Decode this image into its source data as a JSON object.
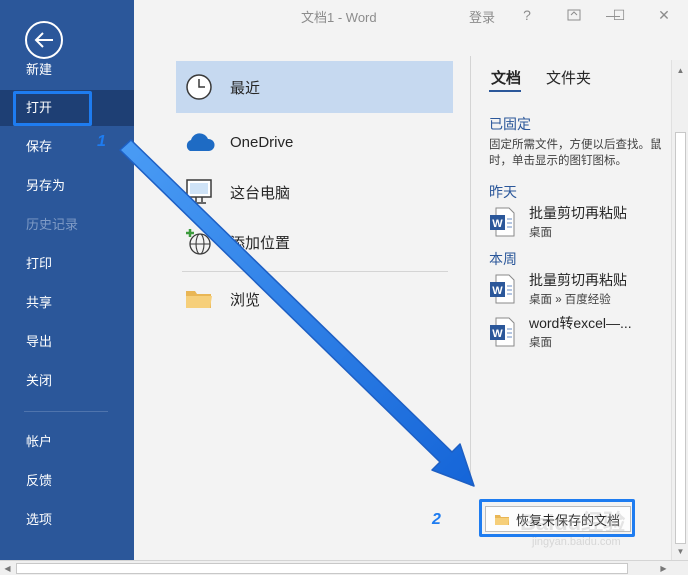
{
  "window": {
    "title": "文档1 -  Word",
    "login": "登录",
    "help": "?",
    "minimize": "—",
    "restore": "☐",
    "close": "✕"
  },
  "sidebar": {
    "items": [
      {
        "label": "新建"
      },
      {
        "label": "打开"
      },
      {
        "label": "保存"
      },
      {
        "label": "另存为"
      },
      {
        "label": "历史记录"
      },
      {
        "label": "打印"
      },
      {
        "label": "共享"
      },
      {
        "label": "导出"
      },
      {
        "label": "关闭"
      },
      {
        "label": "帐户"
      },
      {
        "label": "反馈"
      },
      {
        "label": "选项"
      }
    ]
  },
  "locations": [
    {
      "label": "最近",
      "icon": "clock-icon"
    },
    {
      "label": "OneDrive",
      "icon": "cloud-icon"
    },
    {
      "label": "这台电脑",
      "icon": "computer-icon"
    },
    {
      "label": "添加位置",
      "icon": "globe-add-icon"
    },
    {
      "label": "浏览",
      "icon": "folder-icon"
    }
  ],
  "tabs": [
    {
      "label": "文档"
    },
    {
      "label": "文件夹"
    }
  ],
  "pinned": {
    "heading": "已固定",
    "desc_line1": "固定所需文件，方便以后查找。鼠",
    "desc_line2": "时，单击显示的图钉图标。"
  },
  "yesterday": {
    "heading": "昨天",
    "files": [
      {
        "name": "批量剪切再粘贴",
        "path": "桌面"
      }
    ]
  },
  "this_week": {
    "heading": "本周",
    "files": [
      {
        "name": "批量剪切再粘贴",
        "path": "桌面 » 百度经验"
      },
      {
        "name": "word转excel—...",
        "path": "桌面"
      }
    ]
  },
  "recover_button": "恢复未保存的文档",
  "callouts": {
    "one": "1",
    "two": "2"
  },
  "watermark": {
    "main": "Baidu经验",
    "sub": "jingyan.baidu.com"
  },
  "colors": {
    "sidebar": "#2b579a",
    "sidebar_active": "#1e3f74",
    "selected_location": "#c6d9f0",
    "highlight": "#1e7cf0"
  }
}
